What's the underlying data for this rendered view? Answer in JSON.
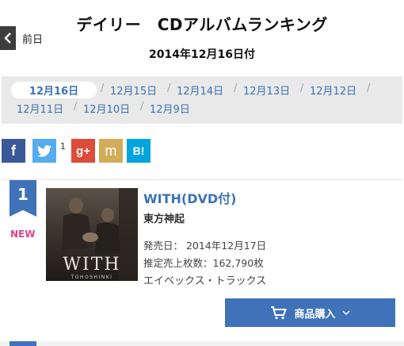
{
  "header": {
    "prev_label": "前日",
    "title": "デイリー　CDアルバムランキング",
    "date": "2014年12月16日付"
  },
  "date_nav": {
    "tabs": [
      "12月16日",
      "12月15日",
      "12月14日",
      "12月13日",
      "12月12日",
      "12月11日",
      "12月10日",
      "12月9日"
    ],
    "separator": "/"
  },
  "social": {
    "facebook": "f",
    "twitter_count": "1",
    "google_plus": "g+",
    "mixi": "m",
    "hatena": "B!"
  },
  "ranking": {
    "rank": "1",
    "badge": "NEW",
    "title": "WITH(DVD付)",
    "artist": "東方神起",
    "release": "発売日： 2014年12月17日",
    "sales": "推定売上枚数：162,790枚",
    "label": "エイベックス・トラックス",
    "buy_label": "商品購入",
    "jacket_text": "WITH",
    "jacket_sub": "TOHOSHINKI"
  },
  "colors": {
    "accent": "#3f72b8",
    "new": "#e0408a",
    "facebook": "#3b5998",
    "twitter": "#55acee",
    "google": "#dd4b39",
    "mixi": "#d1ad59",
    "hatena": "#00a4de"
  }
}
